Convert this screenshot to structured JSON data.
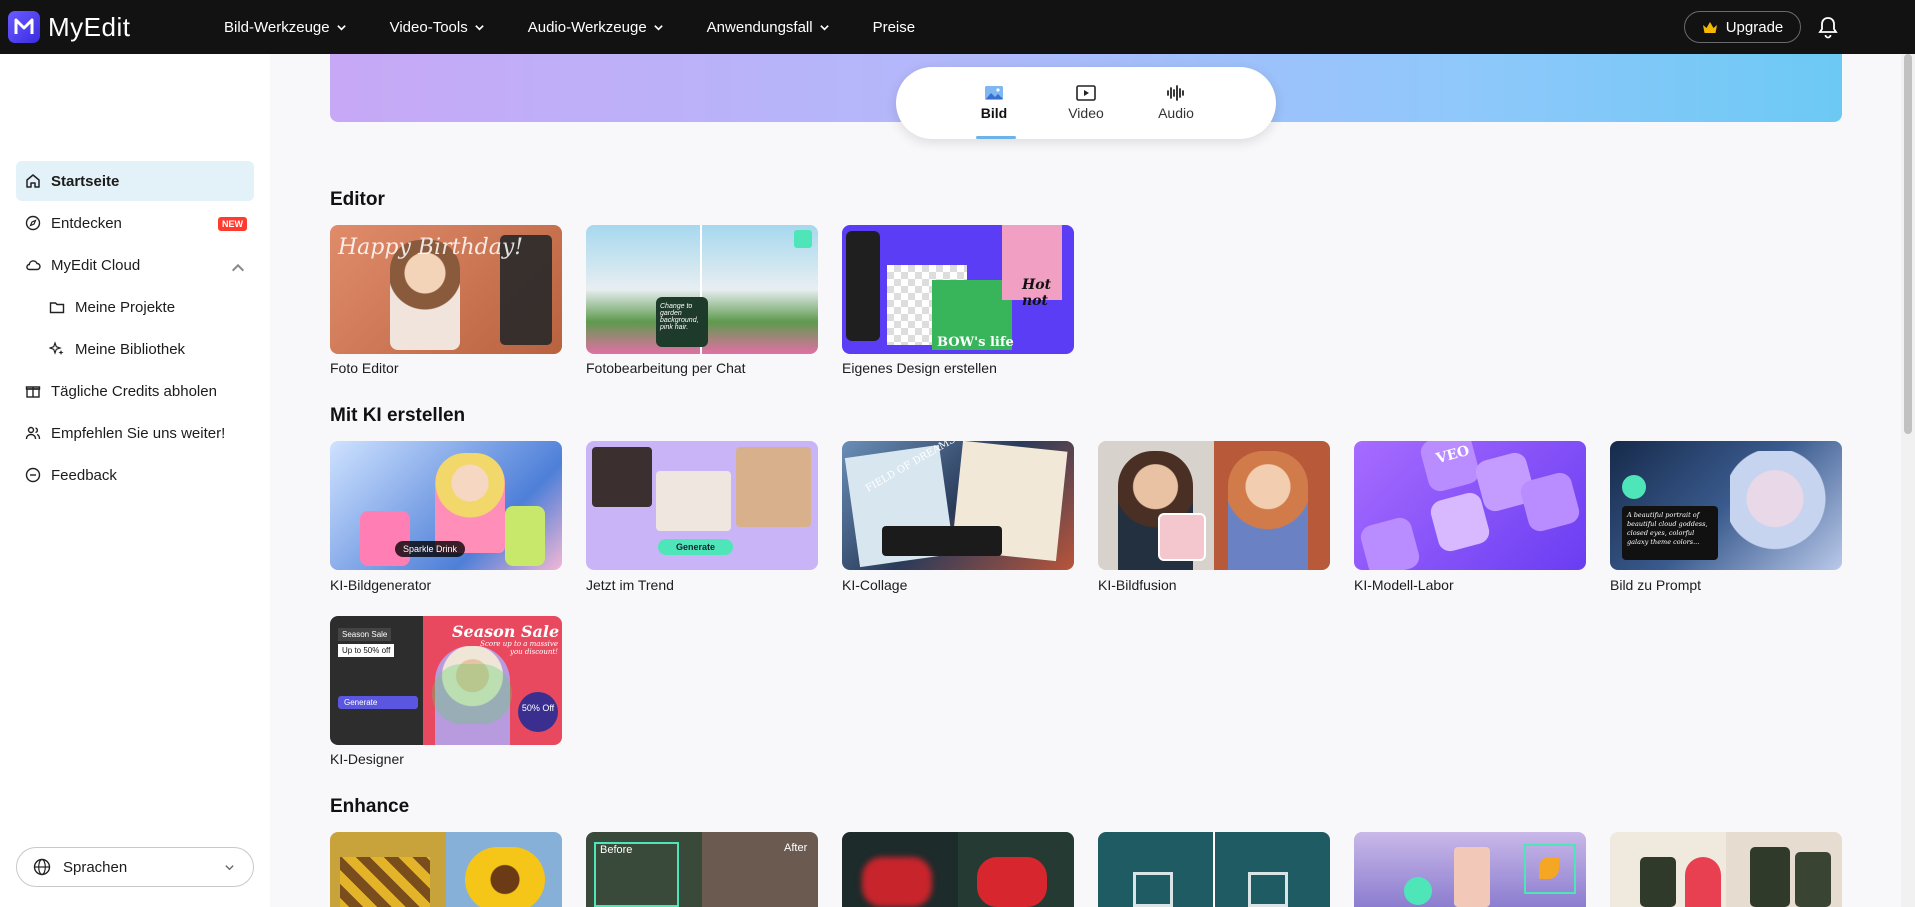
{
  "app": {
    "name": "MyEdit"
  },
  "nav": {
    "items": [
      {
        "label": "Bild-Werkzeuge",
        "has_dropdown": true
      },
      {
        "label": "Video-Tools",
        "has_dropdown": true
      },
      {
        "label": "Audio-Werkzeuge",
        "has_dropdown": true
      },
      {
        "label": "Anwendungsfall",
        "has_dropdown": true
      },
      {
        "label": "Preise",
        "has_dropdown": false
      }
    ],
    "upgrade_label": "Upgrade"
  },
  "sidebar": {
    "items": [
      {
        "label": "Startseite",
        "icon": "home-icon",
        "active": true
      },
      {
        "label": "Entdecken",
        "icon": "compass-icon",
        "badge": "NEW"
      },
      {
        "label": "MyEdit Cloud",
        "icon": "cloud-icon",
        "expanded": true
      },
      {
        "label": "Meine Projekte",
        "icon": "folder-icon"
      },
      {
        "label": "Meine Bibliothek",
        "icon": "sparkle-icon"
      },
      {
        "label": "Tägliche Credits abholen",
        "icon": "gift-icon"
      },
      {
        "label": "Empfehlen Sie uns weiter!",
        "icon": "users-icon"
      },
      {
        "label": "Feedback",
        "icon": "feedback-icon"
      }
    ],
    "language_label": "Sprachen"
  },
  "tabs": [
    {
      "label": "Bild",
      "icon": "image-icon",
      "active": true
    },
    {
      "label": "Video",
      "icon": "video-icon"
    },
    {
      "label": "Audio",
      "icon": "audio-icon"
    }
  ],
  "sections": [
    {
      "title": "Editor",
      "cards": [
        {
          "label": "Foto Editor",
          "overlay": "Happy Birthday!"
        },
        {
          "label": "Fotobearbeitung per Chat",
          "overlay": "Change to garden background, pink hair."
        },
        {
          "label": "Eigenes Design erstellen",
          "overlay": "BOW's life",
          "overlay2": "Hot not"
        }
      ]
    },
    {
      "title": "Mit KI erstellen",
      "cards": [
        {
          "label": "KI-Bildgenerator",
          "overlay": "Sparkle Drink"
        },
        {
          "label": "Jetzt im Trend",
          "overlay": "Generate"
        },
        {
          "label": "KI-Collage",
          "overlay": "FIELD OF DREAMS"
        },
        {
          "label": "KI-Bildfusion"
        },
        {
          "label": "KI-Modell-Labor",
          "overlay": "VEO"
        },
        {
          "label": "Bild zu Prompt",
          "overlay": "A beautiful portrait of beautiful cloud goddess, closed eyes, colorful galaxy theme colors..."
        },
        {
          "label": "KI-Designer",
          "overlay": "Season Sale",
          "overlay2": "50% Off",
          "overlay3": "Score up to a massive you discount!",
          "overlay4": "Up to 50% off",
          "overlay5": "Generate"
        }
      ]
    },
    {
      "title": "Enhance",
      "cards": [
        {
          "overlay": ""
        },
        {
          "overlay": "Before",
          "overlay2": "After"
        },
        {
          "overlay": ""
        },
        {
          "overlay": ""
        },
        {
          "overlay": ""
        },
        {
          "overlay": ""
        }
      ]
    }
  ]
}
